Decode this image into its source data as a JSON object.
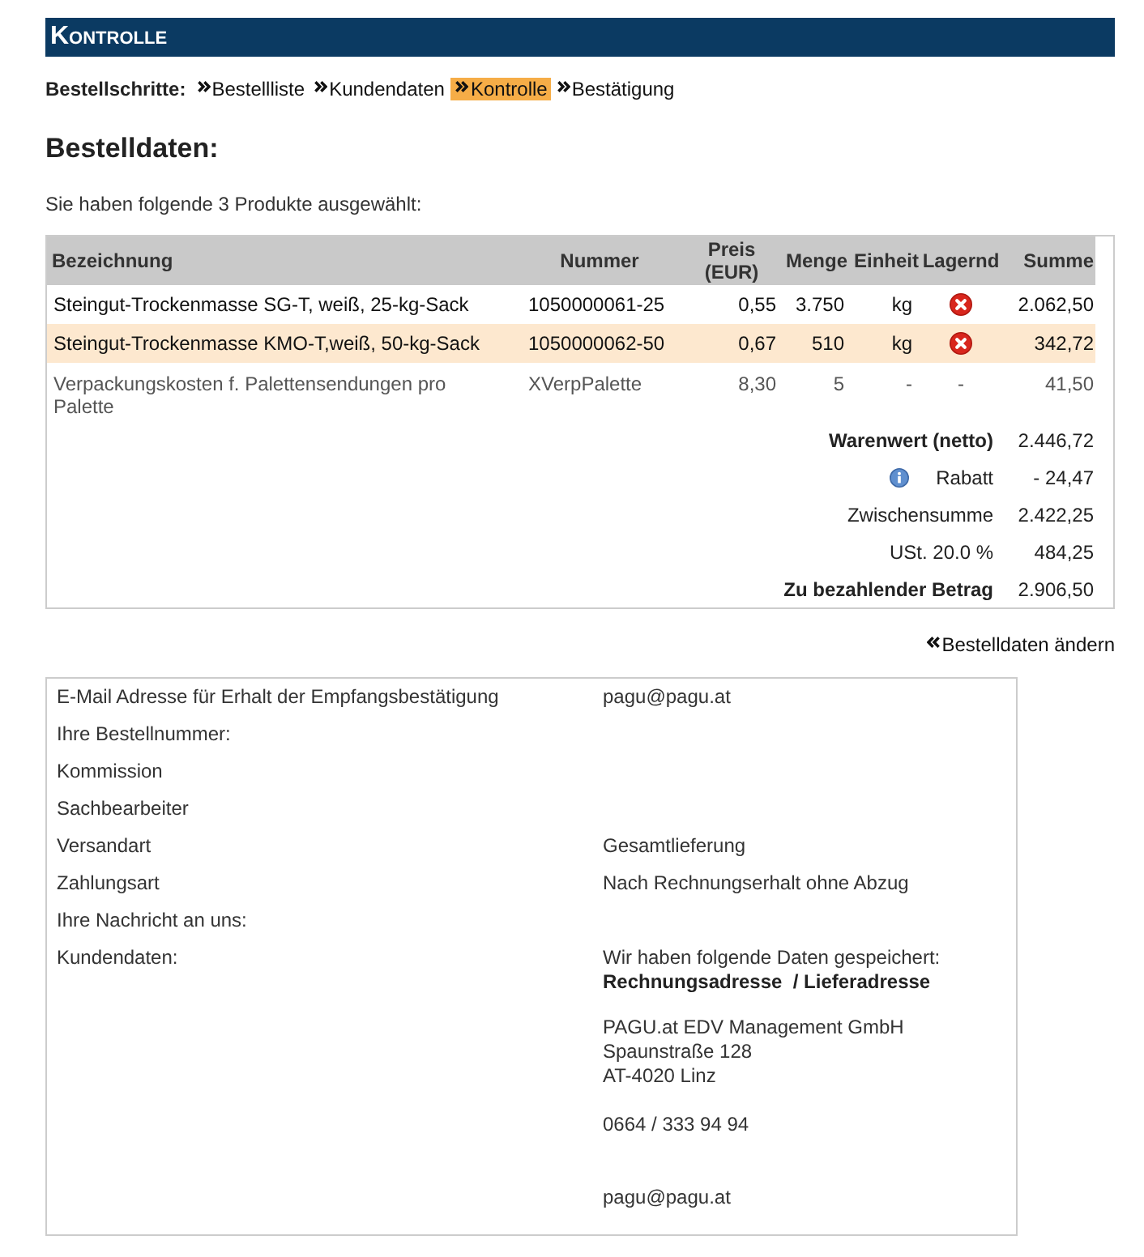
{
  "header": {
    "title": "Kontrolle"
  },
  "steps": {
    "label": "Bestellschritte:",
    "items": [
      {
        "label": "Bestellliste",
        "selected": false
      },
      {
        "label": "Kundendaten",
        "selected": false
      },
      {
        "label": "Kontrolle",
        "selected": true
      },
      {
        "label": "Bestätigung",
        "selected": false
      }
    ]
  },
  "heading": "Bestelldaten:",
  "intro": "Sie haben folgende 3 Produkte ausgewählt:",
  "table": {
    "columns": [
      "Bezeichnung",
      "Nummer",
      "Preis (EUR)",
      "Menge",
      "Einheit",
      "Lagernd",
      "Summe"
    ],
    "rows": [
      {
        "kind": "product",
        "selected": false,
        "name": "Steingut-Trockenmasse SG-T, weiß, 25-kg-Sack",
        "number": "1050000061-25",
        "price": "0,55",
        "quantity": "3.750",
        "unit": "kg",
        "in_stock": false,
        "sum": "2.062,50"
      },
      {
        "kind": "product",
        "selected": true,
        "name": "Steingut-Trockenmasse KMO-T,weiß, 50-kg-Sack",
        "number": "1050000062-50",
        "price": "0,67",
        "quantity": "510",
        "unit": "kg",
        "in_stock": false,
        "sum": "342,72"
      },
      {
        "kind": "fee",
        "selected": false,
        "name": "Verpackungskosten f. Palettensendungen pro Palette",
        "number": "XVerpPalette",
        "price": "8,30",
        "quantity": "5",
        "unit": "-",
        "stock": "-",
        "sum": "41,50"
      }
    ],
    "totals": [
      {
        "label": "Warenwert (netto)",
        "value": "2.446,72",
        "bold": true,
        "info": false
      },
      {
        "label": "Rabatt",
        "value": "- 24,47",
        "bold": false,
        "info": true
      },
      {
        "label": "Zwischensumme",
        "value": "2.422,25",
        "bold": false,
        "info": false
      },
      {
        "label": "USt. 20.0 %",
        "value": "484,25",
        "bold": false,
        "info": false
      },
      {
        "label": "Zu bezahlender Betrag",
        "value": "2.906,50",
        "bold": true,
        "info": false
      }
    ]
  },
  "edit_link": "Bestelldaten ändern",
  "details": {
    "rows": [
      {
        "label": "E-Mail Adresse für Erhalt der Empfangsbestätigung",
        "value": "pagu@pagu.at"
      },
      {
        "label": "Ihre Bestellnummer:"
      },
      {
        "label": "Kommission"
      },
      {
        "label": "Sachbearbeiter"
      },
      {
        "label": "Versandart",
        "value": "Gesamtlieferung"
      },
      {
        "label": "Zahlungsart",
        "value": "Nach Rechnungserhalt ohne Abzug"
      },
      {
        "label": "Ihre Nachricht an uns:"
      }
    ],
    "customer": {
      "label": "Kundendaten:",
      "intro": "Wir haben folgende Daten gespeichert:",
      "address_heading": "Rechnungsadresse  / Lieferadresse",
      "address": [
        "PAGU.at EDV Management GmbH",
        "Spaunstraße 128",
        "AT-4020 Linz"
      ],
      "phone": "0664 / 333 94 94",
      "email": "pagu@pagu.at"
    }
  }
}
